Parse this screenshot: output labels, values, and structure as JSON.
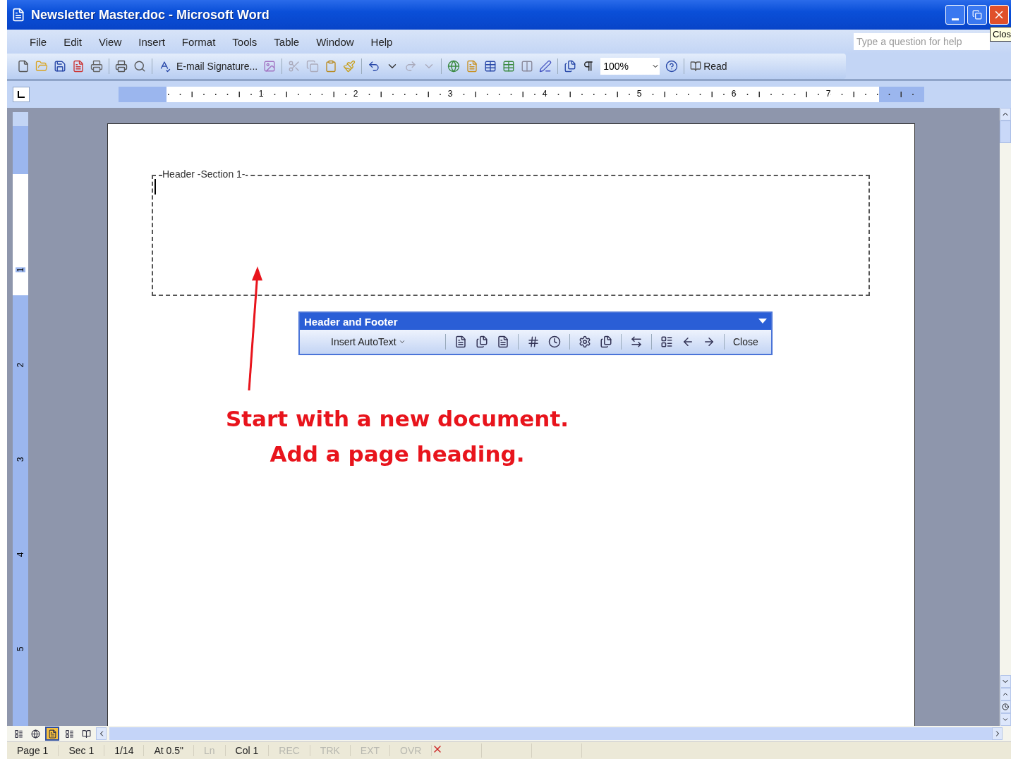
{
  "window": {
    "title": "Newsletter Master.doc - Microsoft Word",
    "tooltip": "Clos"
  },
  "menu": [
    "File",
    "Edit",
    "View",
    "Insert",
    "Format",
    "Tools",
    "Table",
    "Window",
    "Help"
  ],
  "help_box": {
    "placeholder": "Type a question for help"
  },
  "toolbar": {
    "signature_button": "E-mail Signature...",
    "zoom": "100%",
    "read_button": "Read"
  },
  "ruler": {
    "numbers": [
      "1",
      "2",
      "3",
      "4",
      "5",
      "6",
      "7"
    ]
  },
  "vertical_ruler": {
    "numbers": [
      "1",
      "2",
      "3",
      "4",
      "5"
    ]
  },
  "header_area": {
    "label": "Header -Section 1-"
  },
  "header_footer_toolbar": {
    "title": "Header and Footer",
    "autotext_button": "Insert AutoText",
    "close_button": "Close"
  },
  "annotation": {
    "lines": [
      "Start with a new document.",
      "Add a page heading."
    ]
  },
  "view_buttons": [
    {
      "kind": "normal",
      "selected": false
    },
    {
      "kind": "web",
      "selected": false
    },
    {
      "kind": "print",
      "selected": true
    },
    {
      "kind": "outline",
      "selected": false
    },
    {
      "kind": "reading",
      "selected": false
    }
  ],
  "status_bar": [
    {
      "text": "Page 1",
      "disabled": false
    },
    {
      "text": "Sec 1",
      "disabled": false
    },
    {
      "text": "1/14",
      "disabled": false
    },
    {
      "text": "At 0.5\"",
      "disabled": false
    },
    {
      "text": "Ln",
      "disabled": true
    },
    {
      "text": "Col 1",
      "disabled": false
    },
    {
      "text": "REC",
      "disabled": true
    },
    {
      "text": "TRK",
      "disabled": true
    },
    {
      "text": "EXT",
      "disabled": true
    },
    {
      "text": "OVR",
      "disabled": true
    }
  ]
}
